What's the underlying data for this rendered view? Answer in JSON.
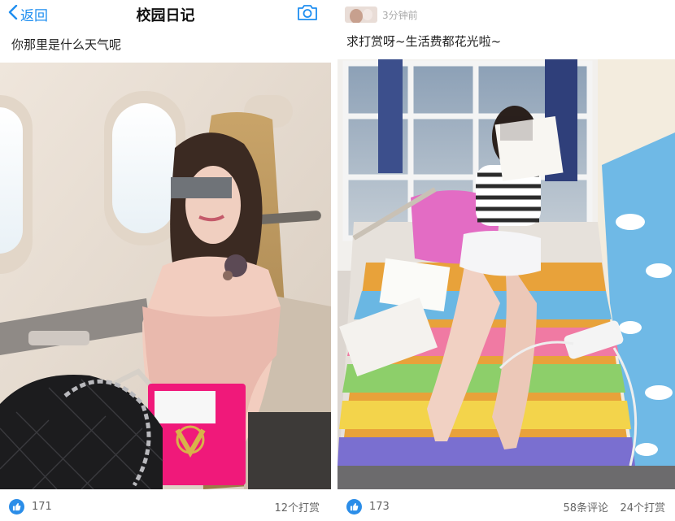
{
  "left": {
    "nav": {
      "back_label": "返回",
      "title": "校园日记",
      "back_icon": "chevron-left-icon",
      "camera_icon": "camera-icon"
    },
    "caption": "你那里是什么天气呢",
    "photo": "woman-in-airplane-seat",
    "footer": {
      "like_icon": "thumbs-up-icon",
      "likes": "171",
      "tips": "12个打赏"
    }
  },
  "right": {
    "header": {
      "avatar": "user-avatar",
      "time": "3分钟前"
    },
    "caption": "求打赏呀~生活费都花光啦~",
    "photo": "woman-on-dorm-bed",
    "footer": {
      "like_icon": "thumbs-up-icon",
      "likes": "173",
      "comments": "58条评论",
      "tips": "24个打赏"
    }
  },
  "colors": {
    "accent": "#1e8ef0",
    "like_badge": "#2b8de8",
    "muted_text": "#666666"
  }
}
